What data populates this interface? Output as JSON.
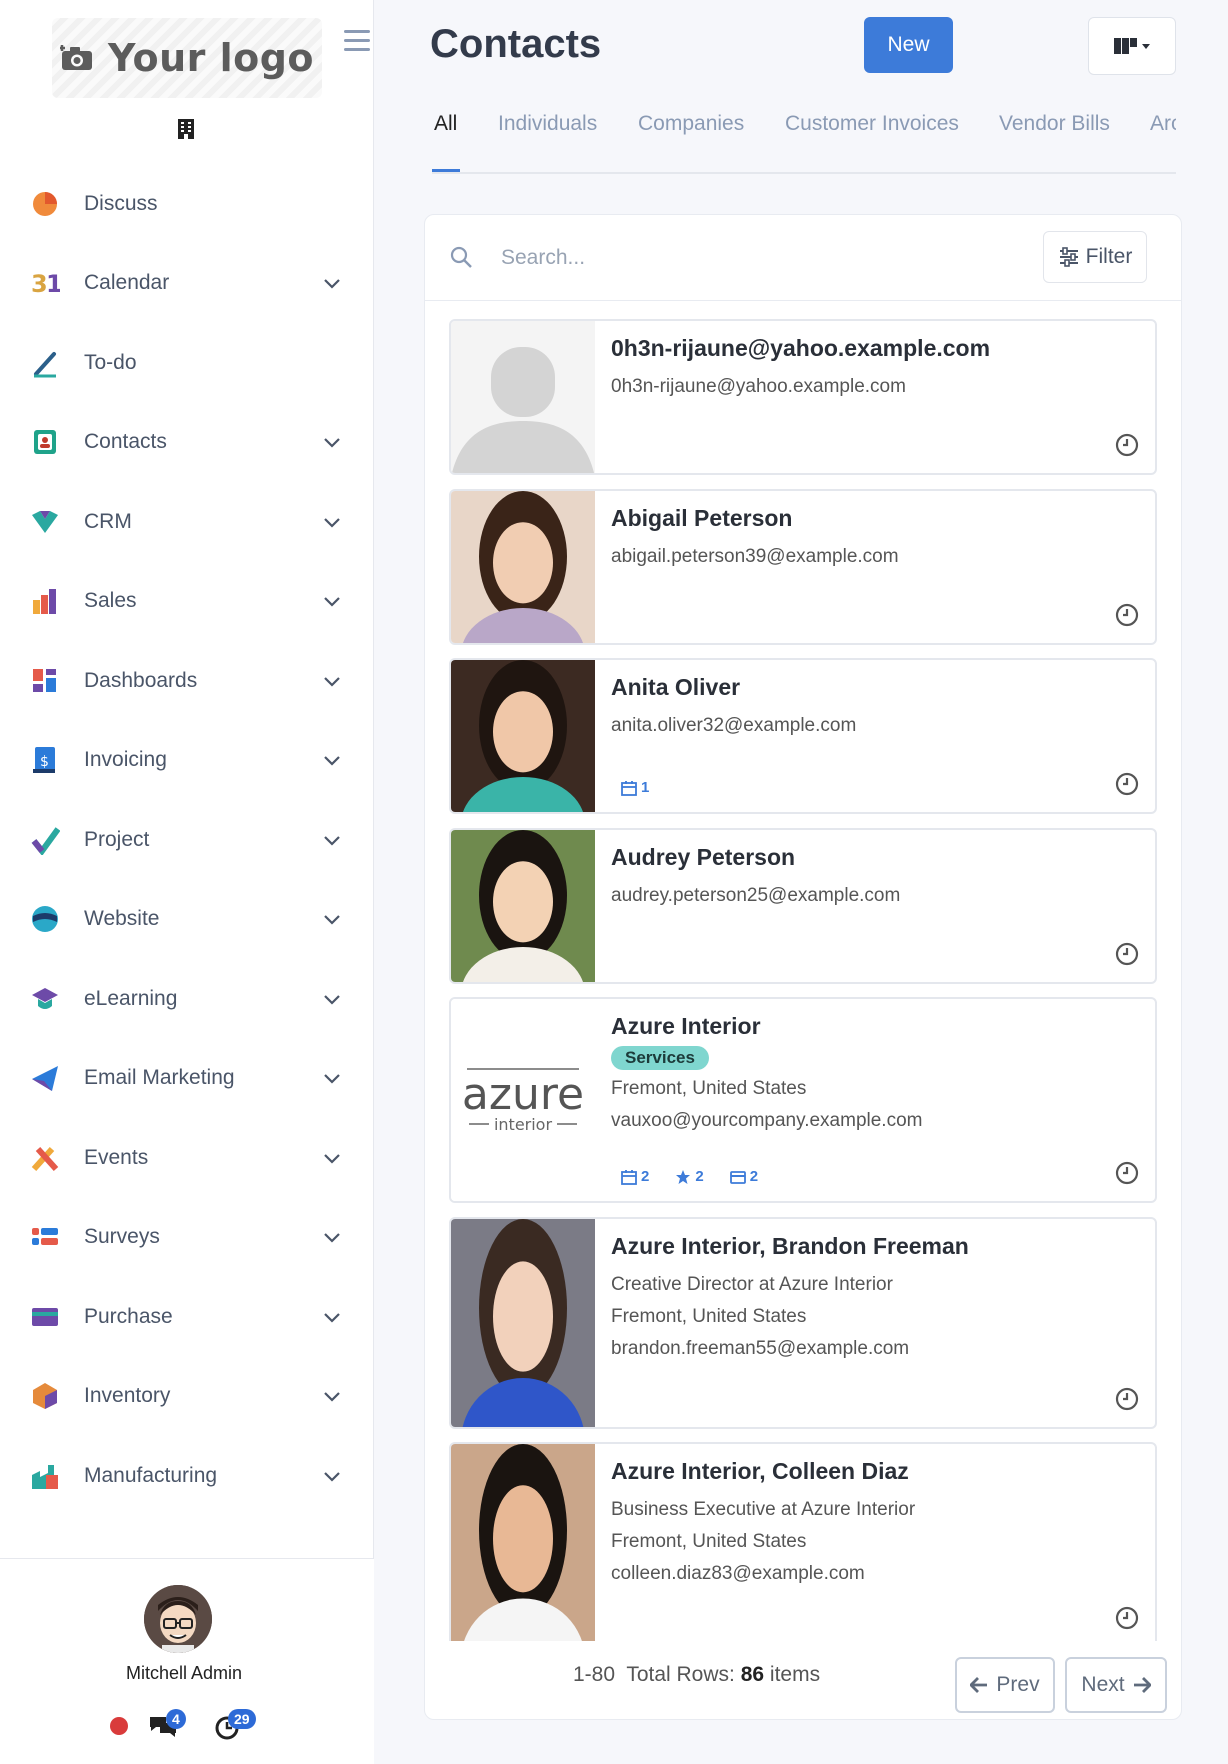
{
  "sidebar": {
    "logo_text": "Your logo",
    "items": [
      {
        "label": "Discuss",
        "icon": "discuss-icon",
        "chevron": false
      },
      {
        "label": "Calendar",
        "icon": "calendar-icon",
        "chevron": true
      },
      {
        "label": "To-do",
        "icon": "todo-icon",
        "chevron": false
      },
      {
        "label": "Contacts",
        "icon": "contacts-icon",
        "chevron": true
      },
      {
        "label": "CRM",
        "icon": "crm-icon",
        "chevron": true
      },
      {
        "label": "Sales",
        "icon": "sales-icon",
        "chevron": true
      },
      {
        "label": "Dashboards",
        "icon": "dashboards-icon",
        "chevron": true
      },
      {
        "label": "Invoicing",
        "icon": "invoicing-icon",
        "chevron": true
      },
      {
        "label": "Project",
        "icon": "project-icon",
        "chevron": true
      },
      {
        "label": "Website",
        "icon": "website-icon",
        "chevron": true
      },
      {
        "label": "eLearning",
        "icon": "elearning-icon",
        "chevron": true
      },
      {
        "label": "Email Marketing",
        "icon": "email-marketing-icon",
        "chevron": true
      },
      {
        "label": "Events",
        "icon": "events-icon",
        "chevron": true
      },
      {
        "label": "Surveys",
        "icon": "surveys-icon",
        "chevron": true
      },
      {
        "label": "Purchase",
        "icon": "purchase-icon",
        "chevron": true
      },
      {
        "label": "Inventory",
        "icon": "inventory-icon",
        "chevron": true
      },
      {
        "label": "Manufacturing",
        "icon": "manufacturing-icon",
        "chevron": true
      }
    ],
    "calendar_icon_text": "31",
    "user": {
      "name": "Mitchell Admin",
      "messages_count": "4",
      "activities_count": "29",
      "status_color": "#d93b3b"
    }
  },
  "header": {
    "title": "Contacts",
    "new_label": "New"
  },
  "tabs": [
    "All",
    "Individuals",
    "Companies",
    "Customer Invoices",
    "Vendor Bills",
    "Arc"
  ],
  "search": {
    "placeholder": "Search...",
    "filter_label": "Filter"
  },
  "contacts": [
    {
      "name": "0h3n-rijaune@yahoo.example.com",
      "lines": [
        "0h3n-rijaune@yahoo.example.com"
      ],
      "image": "placeholder-avatar"
    },
    {
      "name": "Abigail Peterson",
      "lines": [
        "abigail.peterson39@example.com"
      ],
      "image": "photo"
    },
    {
      "name": "Anita Oliver",
      "lines": [
        "anita.oliver32@example.com"
      ],
      "image": "photo",
      "stats": [
        {
          "icon": "calendar-icon",
          "value": "1"
        }
      ]
    },
    {
      "name": "Audrey Peterson",
      "lines": [
        "audrey.peterson25@example.com"
      ],
      "image": "photo"
    },
    {
      "name": "Azure Interior",
      "tag": "Services",
      "lines": [
        "Fremont, United States",
        "vauxoo@yourcompany.example.com"
      ],
      "image": "azure-logo",
      "stats": [
        {
          "icon": "calendar-icon",
          "value": "2"
        },
        {
          "icon": "star-icon",
          "value": "2"
        },
        {
          "icon": "card-icon",
          "value": "2"
        }
      ]
    },
    {
      "name": "Azure Interior, Brandon Freeman",
      "lines": [
        "Creative Director at Azure Interior",
        "Fremont, United States",
        "brandon.freeman55@example.com"
      ],
      "image": "photo"
    },
    {
      "name": "Azure Interior, Colleen Diaz",
      "lines": [
        "Business Executive at Azure Interior",
        "Fremont, United States",
        "colleen.diaz83@example.com"
      ],
      "image": "photo"
    }
  ],
  "azure_logo": {
    "word": "azure",
    "sub": "interior"
  },
  "pager": {
    "range": "1-80",
    "total_label": "Total Rows:",
    "total_value": "86",
    "total_unit": "items",
    "prev_label": "Prev",
    "next_label": "Next"
  },
  "colors": {
    "accent": "#3d7bd9",
    "tag_bg": "#7fd6cf"
  }
}
